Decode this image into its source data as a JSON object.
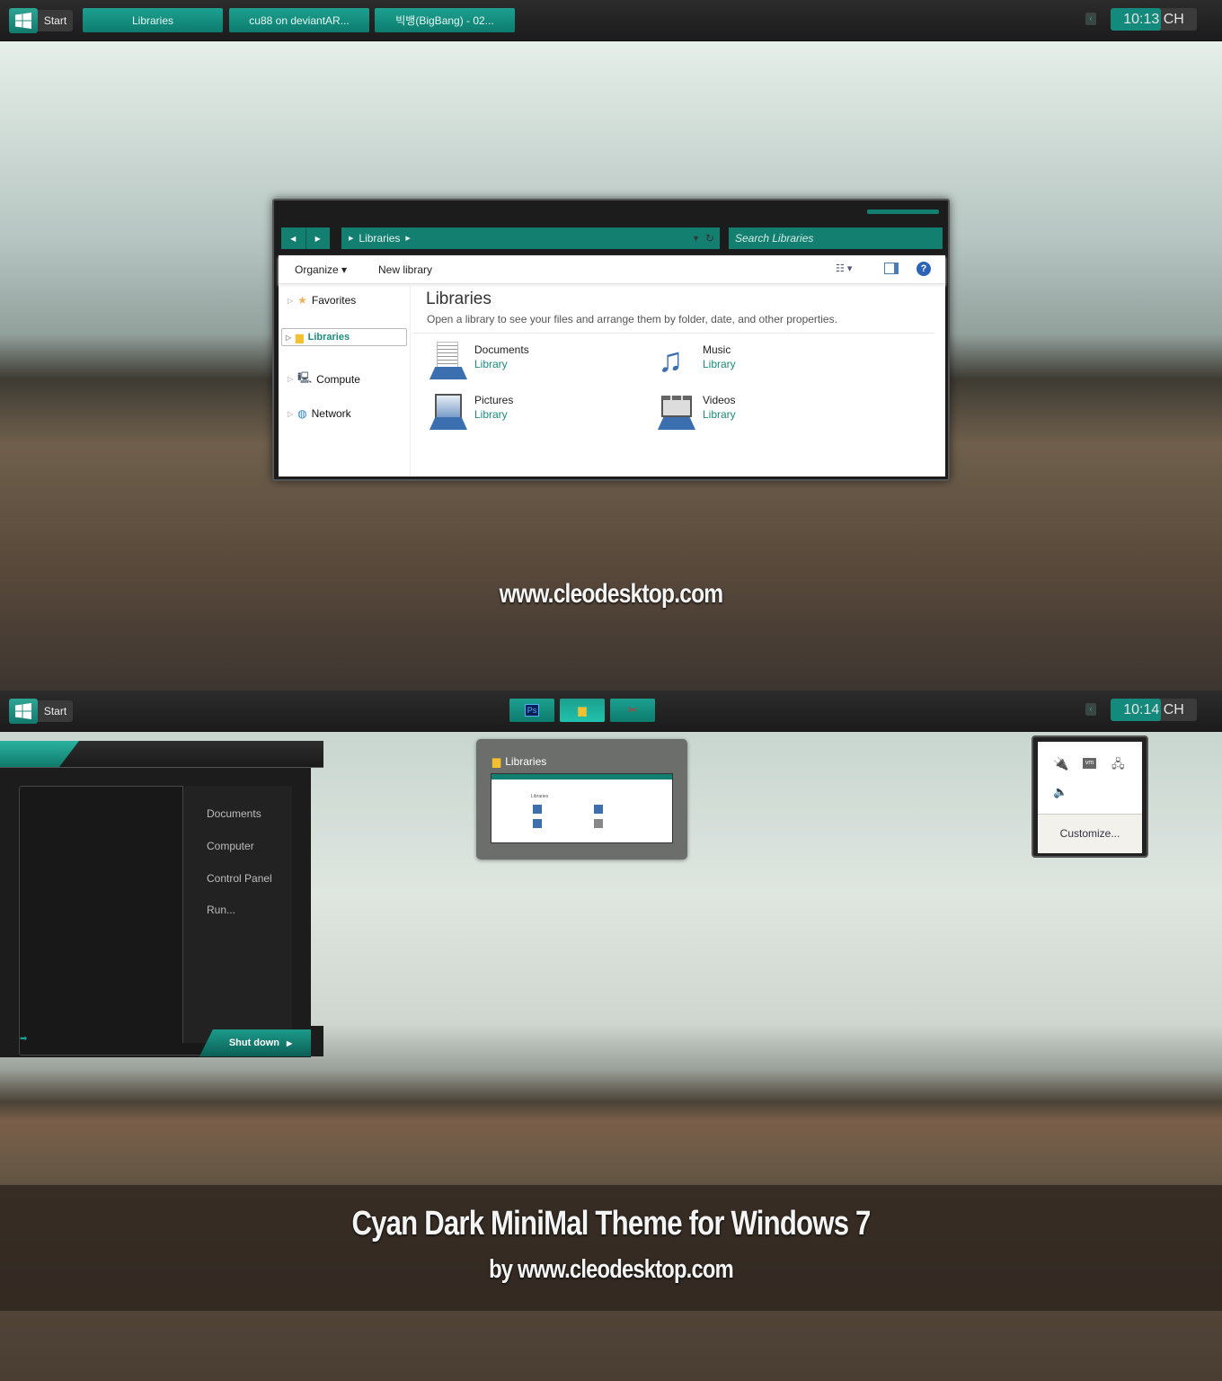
{
  "taskbar_top": {
    "start_label": "Start",
    "buttons": [
      "Libraries",
      "cu88 on deviantAR...",
      "빅뱅(BigBang) - 02..."
    ],
    "clock": "10:13 CH"
  },
  "explorer": {
    "address": "Libraries",
    "search_placeholder": "Search Libraries",
    "toolbar": {
      "organize": "Organize",
      "new_library": "New library"
    },
    "sidebar": [
      "Favorites",
      "Libraries",
      "Compute",
      "Network"
    ],
    "heading": "Libraries",
    "subheading": "Open a library to see your files and arrange them by folder, date, and other properties.",
    "libraries": [
      {
        "name": "Documents",
        "type": "Library"
      },
      {
        "name": "Music",
        "type": "Library"
      },
      {
        "name": "Pictures",
        "type": "Library"
      },
      {
        "name": "Videos",
        "type": "Library"
      }
    ]
  },
  "watermark": "www.cleodesktop.com",
  "taskbar_bottom": {
    "start_label": "Start",
    "clock": "10:14 CH",
    "pinned": [
      "photoshop",
      "libraries",
      "tool"
    ]
  },
  "start_menu": {
    "items": [
      "Documents",
      "Computer",
      "Control Panel",
      "Run..."
    ],
    "shutdown": "Shut down"
  },
  "thumbnail": {
    "title": "Libraries"
  },
  "tray_popup": {
    "customize": "Customize..."
  },
  "banner": {
    "title": "Cyan Dark MiniMal Theme for Windows 7",
    "subtitle": "by www.cleodesktop.com"
  },
  "colors": {
    "accent": "#137f71",
    "dark": "#1c1c1c"
  }
}
